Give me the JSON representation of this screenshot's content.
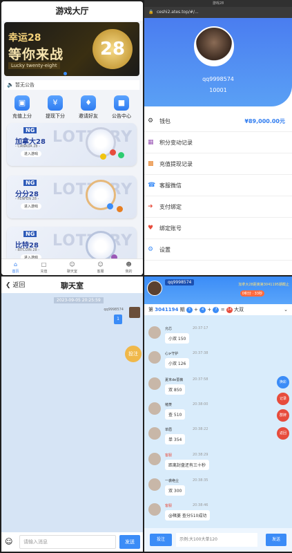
{
  "colors": {
    "accent": "#2f7cf0",
    "chat_bg": "#d6e4f5",
    "room_bg": "#d9ecfb",
    "bet_orange": "#f0b84a",
    "red": "#e74c3c"
  },
  "hall": {
    "title": "游戏大厅",
    "banner": {
      "line1": "幸运28",
      "line2": "等你来战",
      "line3": "Lucky twenty-eight",
      "number": "28"
    },
    "notice": "暂无公告",
    "quick": [
      {
        "label": "充值上分",
        "icon": "wallet-icon"
      },
      {
        "label": "提现下分",
        "icon": "yen-icon"
      },
      {
        "label": "邀请好友",
        "icon": "gift-icon"
      },
      {
        "label": "公告中心",
        "icon": "bell-icon"
      }
    ],
    "games": [
      {
        "logo": "NG",
        "name": "加拿大28",
        "sub": "- CANADA 28 -",
        "enter": "进入游戏"
      },
      {
        "logo": "NG",
        "name": "分分28",
        "sub": "- FENFEN 28 -",
        "enter": "进入游戏"
      },
      {
        "logo": "NG",
        "name": "比特28",
        "sub": "- BITCOIN 28 -",
        "enter": "进入游戏"
      }
    ],
    "watermark": "LOTTERY",
    "tabs": [
      {
        "label": "首页",
        "icon": "home-icon"
      },
      {
        "label": "充值",
        "icon": "lock-icon"
      },
      {
        "label": "聊天室",
        "icon": "users-icon"
      },
      {
        "label": "客服",
        "icon": "service-icon"
      },
      {
        "label": "我的",
        "icon": "user-icon"
      }
    ]
  },
  "profile": {
    "window_title": "游戏28",
    "address": "ceshi2.ates.top/#/...",
    "username": "qq9998574",
    "user_id": "10001",
    "menu": [
      {
        "label": "钱包",
        "icon": "gear-icon",
        "value": "¥89,000.00元"
      },
      {
        "label": "积分变动记录",
        "icon": "list-icon"
      },
      {
        "label": "充值提现记录",
        "icon": "chart-icon"
      },
      {
        "label": "客服微信",
        "icon": "headset-icon"
      },
      {
        "label": "支付绑定",
        "icon": "login-icon"
      },
      {
        "label": "绑定账号",
        "icon": "heart-icon"
      },
      {
        "label": "设置",
        "icon": "settings-icon"
      }
    ]
  },
  "chat": {
    "back": "返回",
    "title": "聊天室",
    "time": "2023-09-05 20:25:59",
    "user": "qq9998574",
    "message": "1",
    "bet_button": "投注",
    "placeholder": "请输入消息",
    "send": "发送"
  },
  "room": {
    "username": "qq9998574",
    "marquee": "加拿大28距离第3041195期截止",
    "points": "0积分 · 33秒",
    "period_prefix": "第",
    "period": "3041194",
    "period_suffix": "期",
    "balls": [
      "3",
      "4",
      "7",
      "14"
    ],
    "result": "大双",
    "messages": [
      {
        "user": "允芯",
        "time": "20:37:17",
        "text": "小双 150"
      },
      {
        "user": "心≯守护",
        "time": "20:37:38",
        "text": "小双 126"
      },
      {
        "user": "夏末de蔷薇",
        "time": "20:37:58",
        "text": "双 850"
      },
      {
        "user": "楮菱",
        "time": "20:38:00",
        "text": "查 510"
      },
      {
        "user": "单眉",
        "time": "20:38:22",
        "text": "单 354"
      },
      {
        "user": "客服",
        "time": "20:38:29",
        "text": "距离封盘还有三十秒"
      },
      {
        "user": "一袭绝尘",
        "time": "20:38:35",
        "text": "双 300"
      },
      {
        "user": "客服",
        "time": "20:38:46",
        "text": "@楮菱 查分510成功"
      }
    ],
    "side_buttons": [
      "换彩",
      "记录",
      "群牌",
      "返回"
    ],
    "bet_button": "投注",
    "placeholder": "示例:大100大单120",
    "send": "发送"
  }
}
